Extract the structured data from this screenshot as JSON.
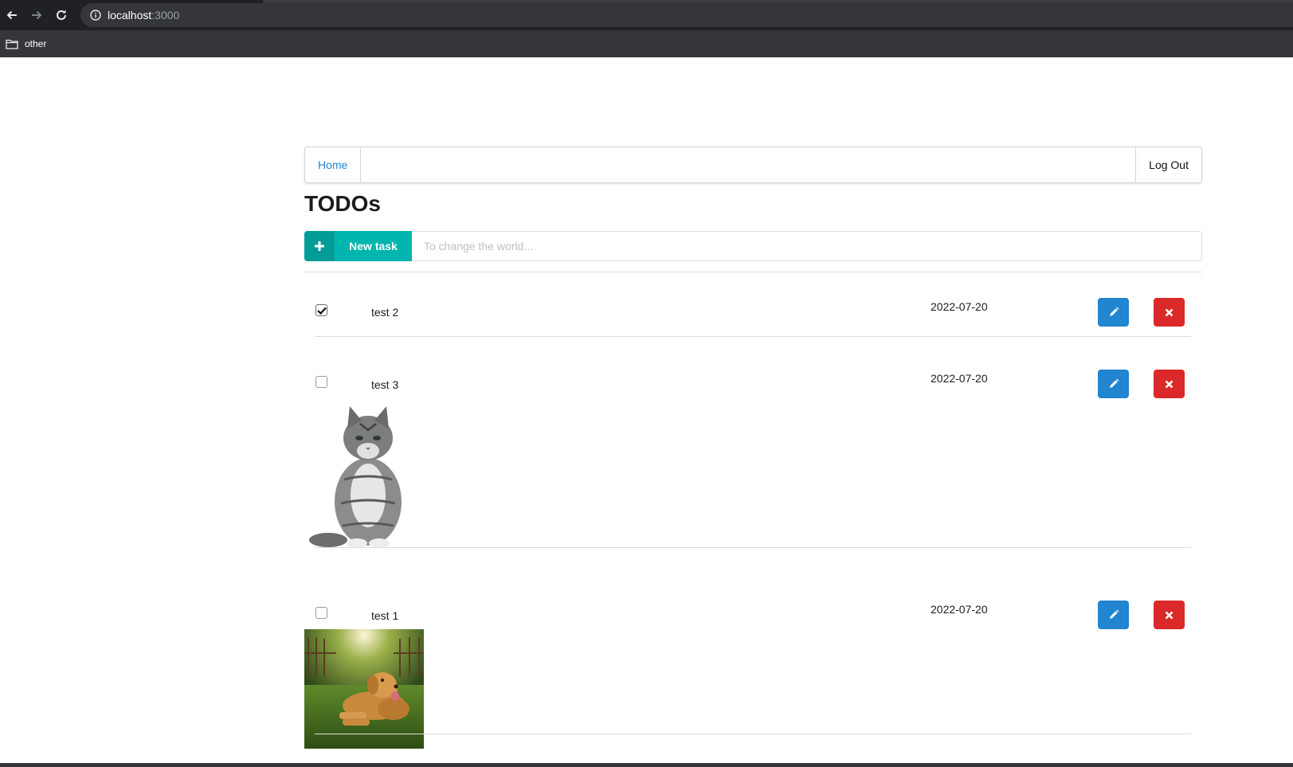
{
  "browser": {
    "url_host": "localhost",
    "url_port": ":3000",
    "bookmarks": [
      {
        "label": "other",
        "icon": "folder-icon"
      }
    ]
  },
  "menu": {
    "home_label": "Home",
    "logout_label": "Log Out"
  },
  "page": {
    "title": "TODOs"
  },
  "new_task": {
    "button_label": "New task",
    "button_icon": "plus-icon",
    "input_value": "",
    "input_placeholder": "To change the world..."
  },
  "todos": [
    {
      "name": "test 2",
      "date": "2022-07-20",
      "done": true,
      "image": null
    },
    {
      "name": "test 3",
      "date": "2022-07-20",
      "done": false,
      "image": "cat-photo"
    },
    {
      "name": "test 1",
      "date": "2022-07-20",
      "done": false,
      "image": "dog-photo"
    }
  ],
  "colors": {
    "primary": "#2185d0",
    "danger": "#db2828",
    "teal": "#00b5ad"
  }
}
